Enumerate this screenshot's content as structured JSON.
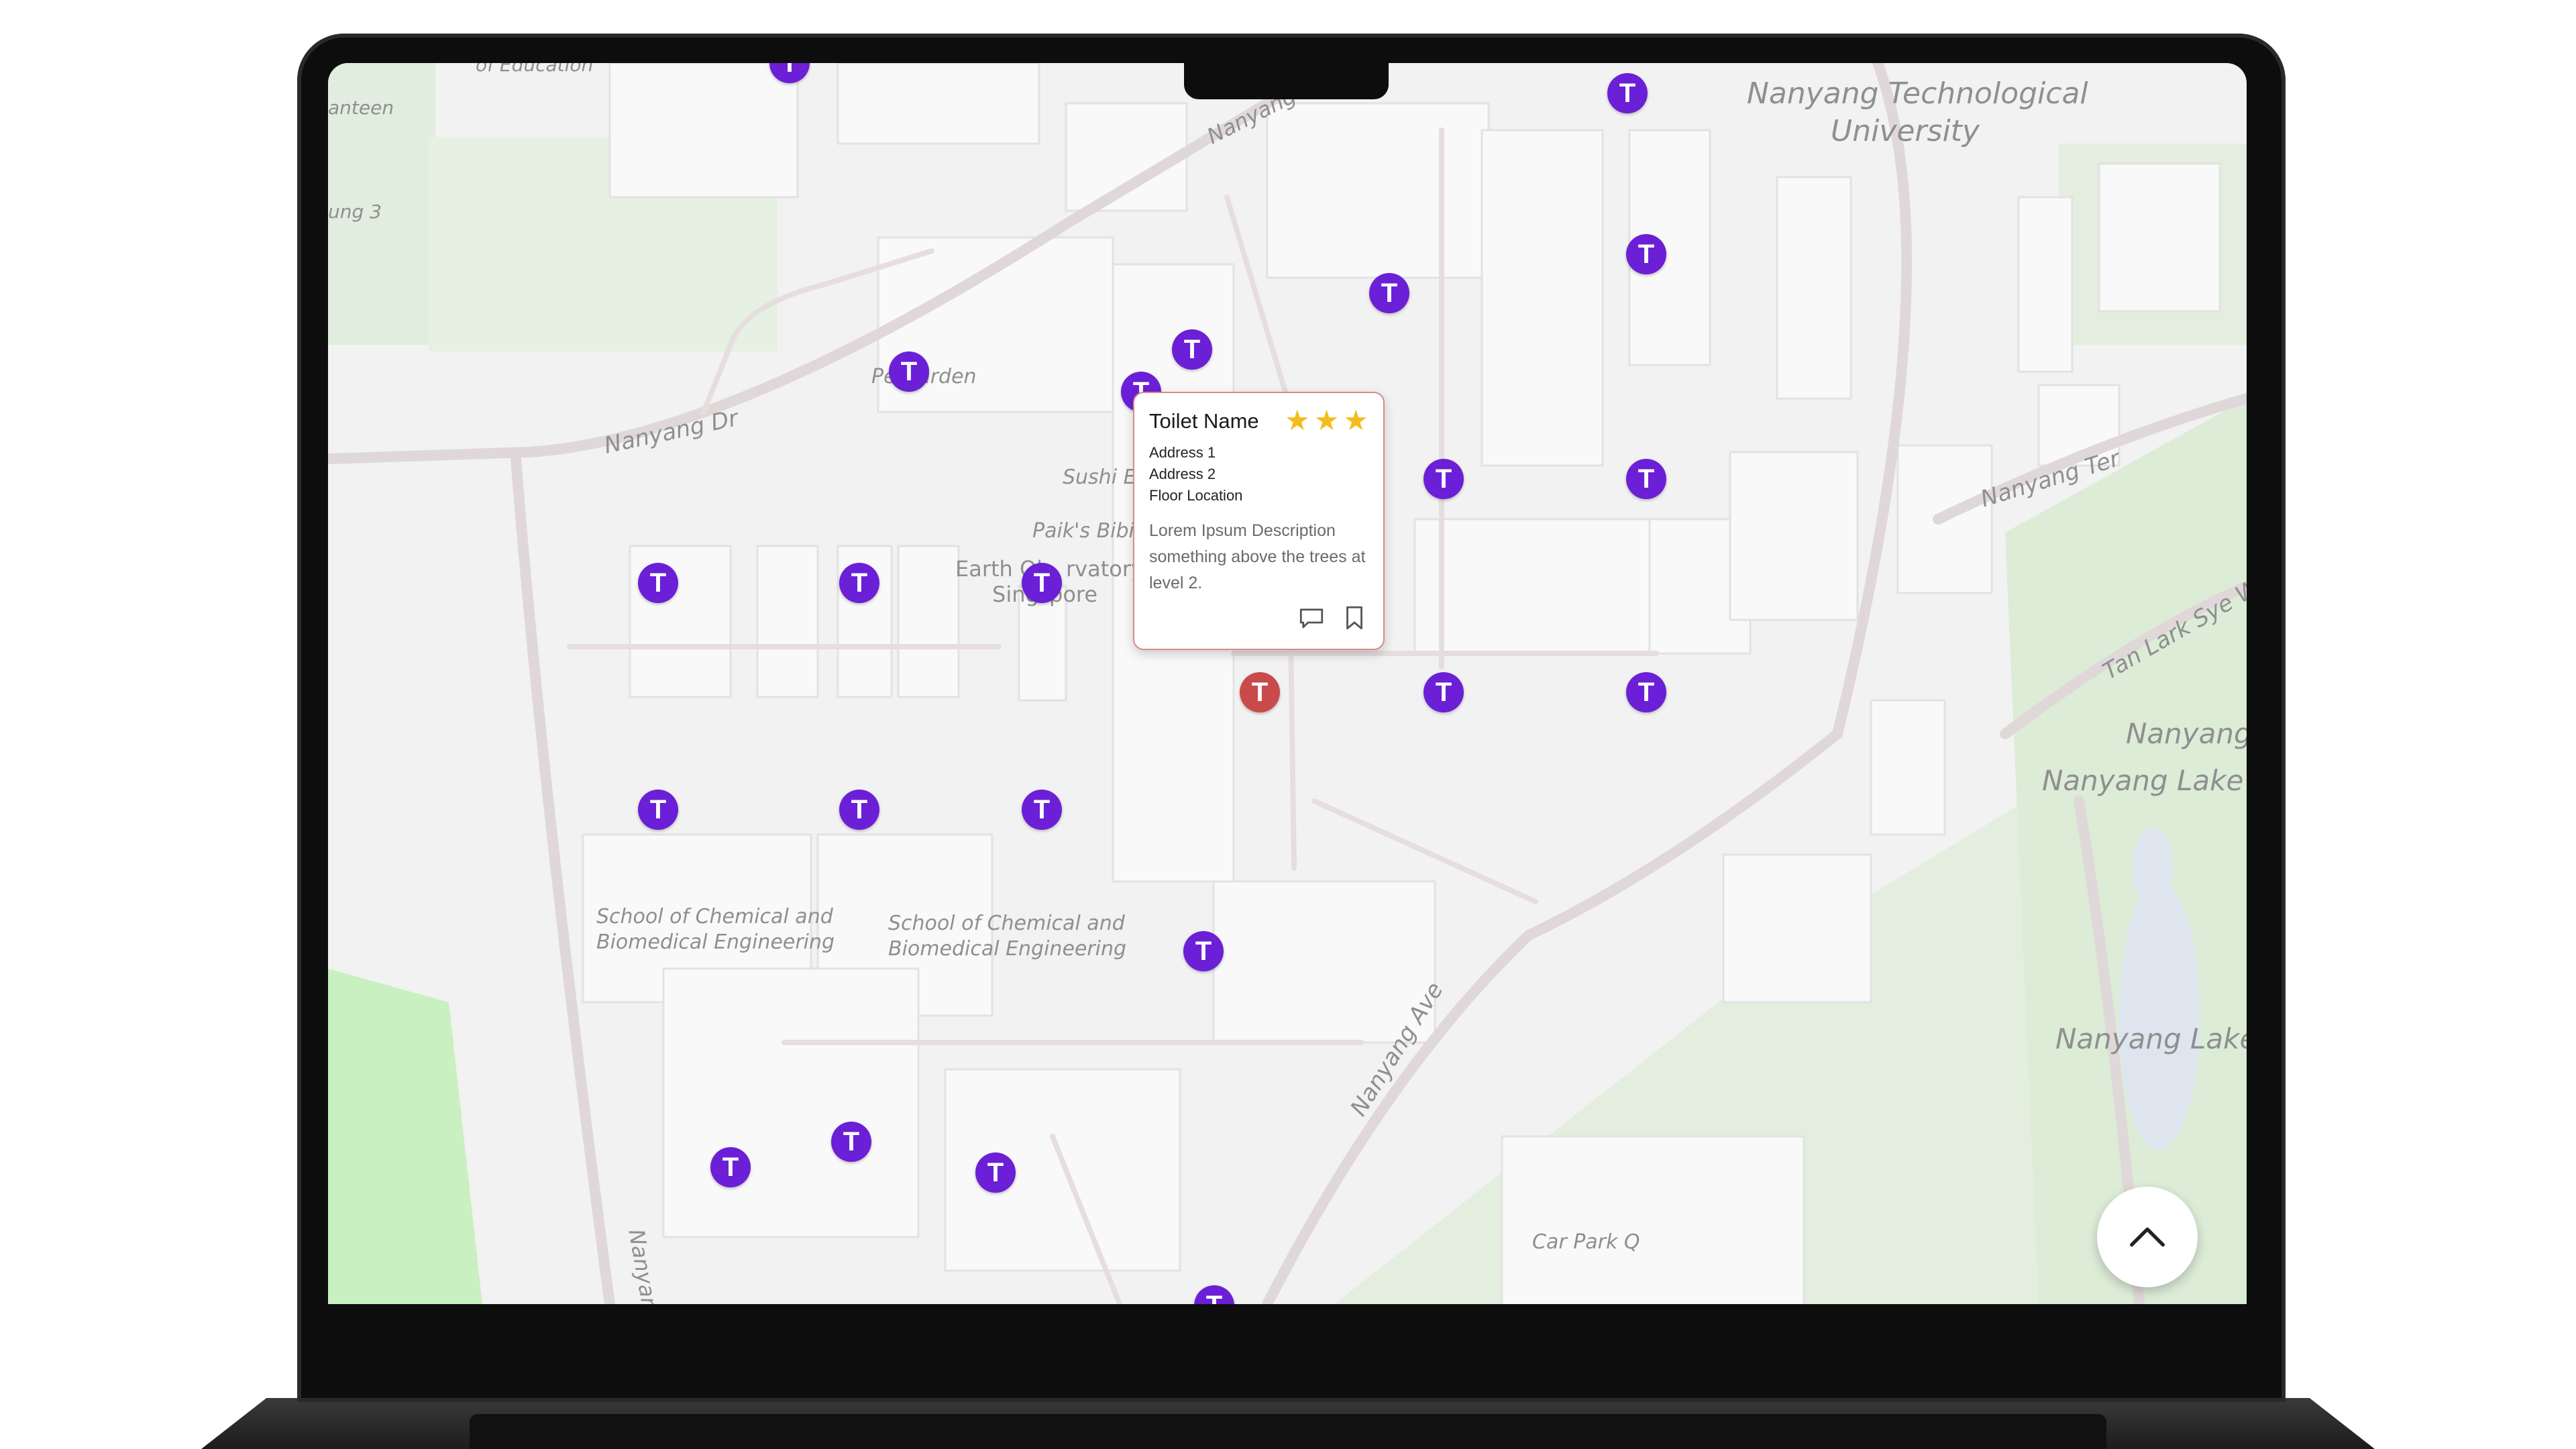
{
  "popup": {
    "title": "Toilet Name",
    "rating": 3,
    "address1": "Address 1",
    "address2": "Address 2",
    "floor": "Floor Location",
    "description": "Lorem Ipsum Description something above the trees at level 2."
  },
  "pins": {
    "label": "T",
    "color": "#6b1fd6",
    "selected_color": "#c94a4a"
  },
  "map_labels": {
    "ntu_line1": "Nanyang Technological",
    "ntu_line2": "University",
    "nanyang_dr": "Nanyang Dr",
    "nanyang_dr_top": "Nanyang",
    "nanyang_ter": "Nanyang Ter",
    "tan_lark_sye": "Tan Lark Sye Wa",
    "nanyang_partial": "Nanyang L",
    "nanyang_lake_1": "Nanyang Lake",
    "nanyang_lake_2": "Nanyang Lake",
    "nanyang_ave": "Nanyang Ave",
    "car_park": "Car Park Q",
    "nanyang_bottom": "Nanyang",
    "garden": "Pe   Garden",
    "sushi": "Sushi Ex",
    "paiks": "Paik's Bibim",
    "earth_obs_1": "Earth Ol",
    "earth_obs_1b": "rvatory",
    "earth_obs_2": "Sing",
    "earth_obs_2b": "pore",
    "chem_a_1": "School of Chemical and",
    "chem_a_2": "Biomedical Engineering",
    "chem_b_1": "School of Chemical and",
    "chem_b_2": "Biomedical Engineering",
    "canteen": "anteen",
    "education": "of Education",
    "ung3": "ung 3"
  }
}
